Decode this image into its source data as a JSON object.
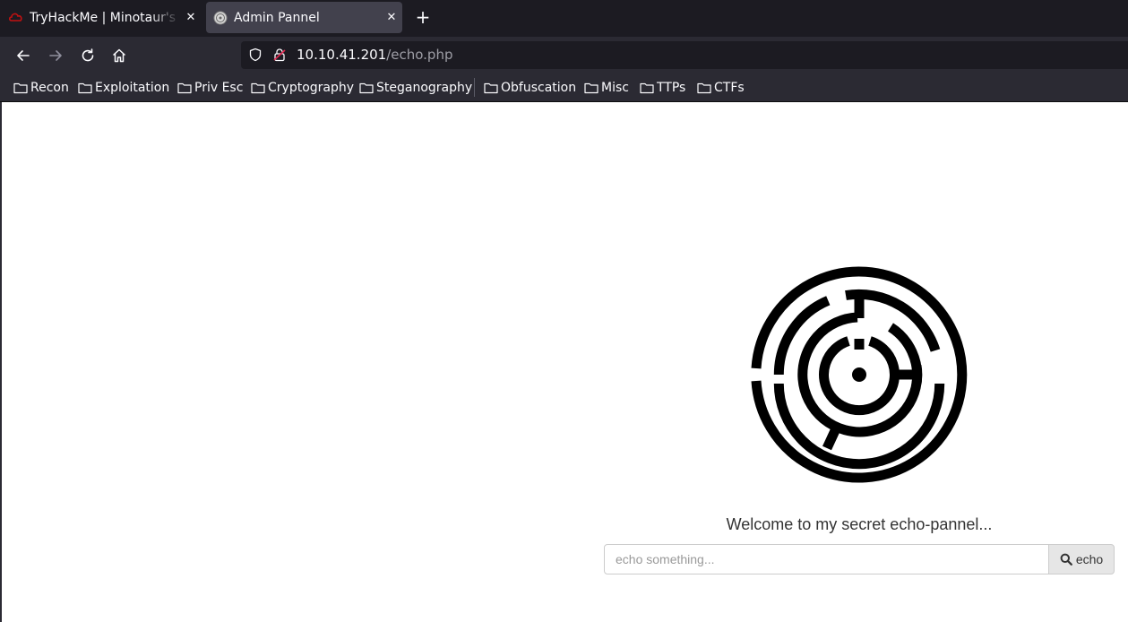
{
  "tabs": [
    {
      "title": "TryHackMe | Minotaur's Labyrinth",
      "icon": "tryhackme-logo-icon",
      "active": false
    },
    {
      "title": "Admin Pannel",
      "icon": "site-favicon-icon",
      "active": true
    }
  ],
  "url": {
    "host": "10.10.41.201",
    "path": "/echo.php"
  },
  "bookmarks": [
    "Recon",
    "Exploitation",
    "Priv Esc",
    "Cryptography",
    "Steganography",
    "Obfuscation",
    "Misc",
    "TTPs",
    "CTFs"
  ],
  "page": {
    "welcome": "Welcome to my secret echo-pannel...",
    "input_placeholder": "echo something...",
    "button_label": "echo"
  },
  "colors": {
    "tab_strip": "#1c1b22",
    "toolbar": "#2b2a33",
    "active_tab": "#42414d",
    "tryhackme_red": "#c11111"
  }
}
